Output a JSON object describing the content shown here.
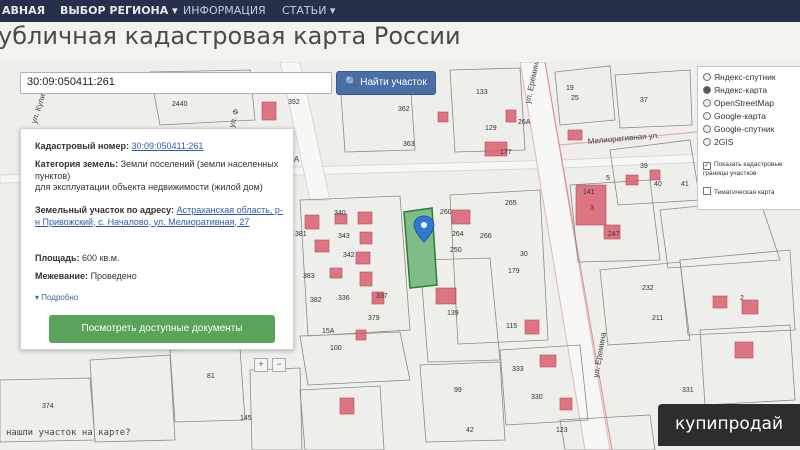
{
  "nav": {
    "items": [
      "АВНАЯ",
      "ВЫБОР РЕГИОНА ▾",
      "ИНФОРМАЦИЯ",
      "СТАТЬИ ▾"
    ]
  },
  "page": {
    "title": "убличная кадастровая карта России"
  },
  "search": {
    "value": "30:09:050411:261",
    "button_label": "Найти участок"
  },
  "info": {
    "cadastral_label": "Кадастровый номер:",
    "cadastral_number": "30:09:050411:261",
    "category_label": "Категория земель:",
    "category_value": "Земли поселений (земли населенных пунктов)",
    "usage_value": "для эксплуатации объекта недвижимости (жилой дом)",
    "address_label": "Земельный участок по адресу:",
    "address_value": "Астраханская область, р-н Привожский, с. Началово, ул. Мелиоративная, 27",
    "area_label": "Площадь:",
    "area_value": "600 кв.м.",
    "survey_label": "Межевание:",
    "survey_value": "Проведено",
    "more_label": "Подробно",
    "docs_button": "Посмотреть доступные документы"
  },
  "layers": {
    "options": [
      "Яндекс-спутник",
      "Яндекс-карта",
      "OpenStreetMap",
      "Google-карта",
      "Google-спутник",
      "2GIS"
    ],
    "selected": "Яндекс-карта",
    "checkbox1": "Показать кадастровые границы участков",
    "checkbox2": "Тематическая карта"
  },
  "map": {
    "streets": [
      "ул. Кулибинов",
      "ул. Ф",
      "ул. Ерёмина",
      "Мелиоративная ул.",
      "ул. Еремина",
      "ул. 23А"
    ],
    "parcel_numbers": [
      "2440",
      "392",
      "362",
      "363",
      "133",
      "129",
      "26А",
      "177",
      "19",
      "25",
      "37",
      "41",
      "39",
      "40",
      "141",
      "265",
      "266",
      "264",
      "260",
      "250",
      "340",
      "343",
      "342",
      "383",
      "382",
      "381",
      "336",
      "337",
      "379",
      "30",
      "179",
      "139",
      "15А",
      "100",
      "333",
      "232",
      "211",
      "331",
      "115",
      "81",
      "374",
      "99",
      "330",
      "42",
      "123",
      "145",
      "247",
      "3",
      "2",
      "5"
    ]
  },
  "bottom": {
    "text": "нашли участок на карте?"
  },
  "watermark": {
    "text": "купипродай"
  }
}
